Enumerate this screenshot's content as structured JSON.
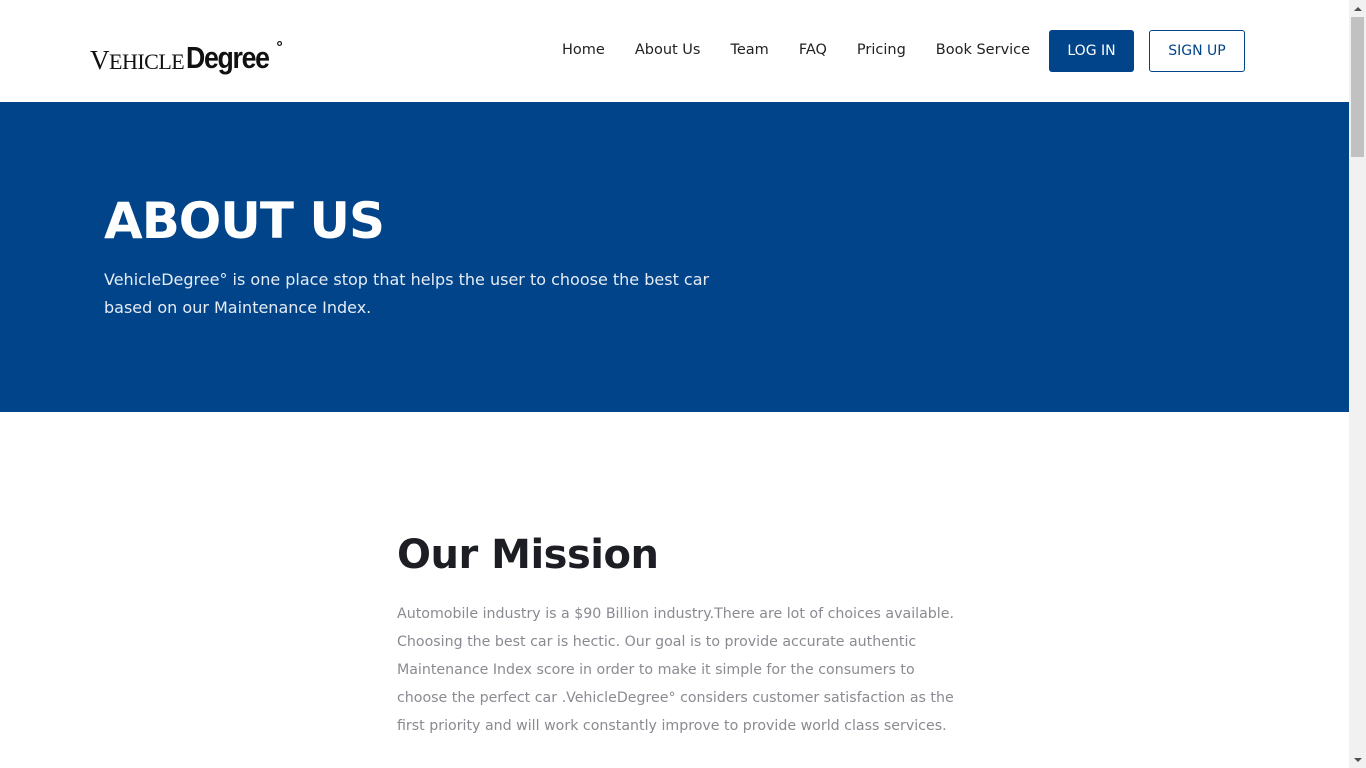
{
  "header": {
    "logo": {
      "part1_first": "V",
      "part1_rest": "EHICLE",
      "part2": "Degree",
      "degree_mark": "°"
    },
    "nav": [
      {
        "label": "Home"
      },
      {
        "label": "About Us"
      },
      {
        "label": "Team"
      },
      {
        "label": "FAQ"
      },
      {
        "label": "Pricing"
      },
      {
        "label": "Book Service"
      }
    ],
    "login_label": "LOG IN",
    "signup_label": "SIGN UP"
  },
  "hero": {
    "title": "ABOUT US",
    "text": "VehicleDegree° is one place stop that helps the user to choose the best car based on our Maintenance Index."
  },
  "mission": {
    "title": "Our Mission",
    "text": "Automobile industry is a $90 Billion industry.There are lot of choices available. Choosing the best car is hectic. Our goal is to provide accurate authentic Maintenance Index score in order to make it simple for the consumers to choose the perfect car .VehicleDegree° considers customer satisfaction as the first priority and will work constantly improve to provide world class services."
  },
  "colors": {
    "brand_blue": "#01448a",
    "heading_dark": "#1d1d24",
    "body_gray": "#8a8a92"
  },
  "scrollbar": {
    "up_icon": "chevron-up-icon",
    "down_icon": "chevron-down-icon"
  }
}
